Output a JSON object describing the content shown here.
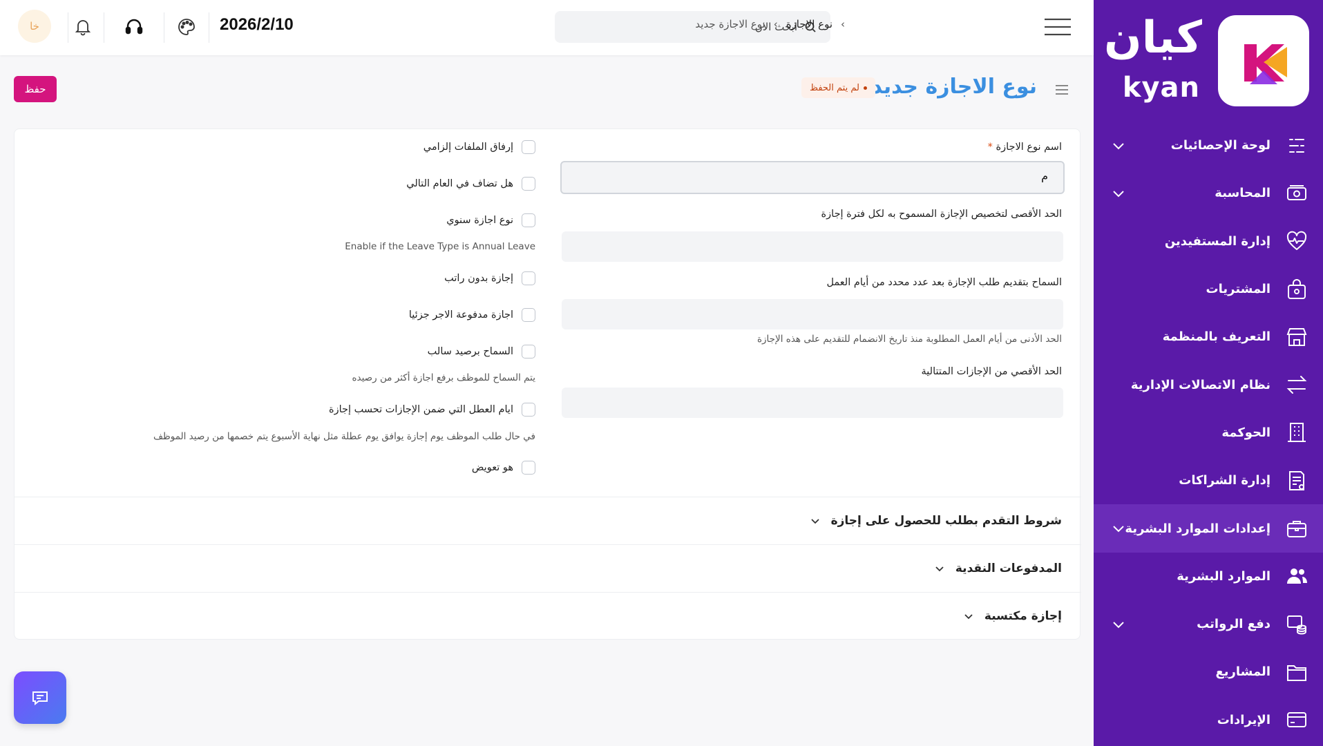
{
  "brand": {
    "name_ar": "كيان",
    "name_en": "kyan",
    "logo_letter": "k",
    "colors": {
      "sidebar": "#5a1aa8",
      "accent": "#d4147e",
      "title": "#3b8fe0",
      "logo_orange": "#f5a623"
    }
  },
  "sidebar": {
    "items": [
      {
        "label": "لوحة الإحصائيات",
        "icon": "stats-icon",
        "has_chevron": true,
        "active": false
      },
      {
        "label": "المحاسبة",
        "icon": "money-icon",
        "has_chevron": true,
        "active": false
      },
      {
        "label": "إدارة المستفيدين",
        "icon": "heart-pulse-icon",
        "has_chevron": false,
        "active": false
      },
      {
        "label": "المشتريات",
        "icon": "bag-icon",
        "has_chevron": false,
        "active": false
      },
      {
        "label": "التعريف بالمنظمة",
        "icon": "store-icon",
        "has_chevron": false,
        "active": false
      },
      {
        "label": "نظام الاتصالات الإدارية",
        "icon": "arrows-icon",
        "has_chevron": false,
        "active": false
      },
      {
        "label": "الحوكمة",
        "icon": "building-icon",
        "has_chevron": false,
        "active": false
      },
      {
        "label": "إدارة الشراكات",
        "icon": "document-icon",
        "has_chevron": false,
        "active": false
      },
      {
        "label": "إعدادات الموارد البشرية",
        "icon": "briefcase-icon",
        "has_chevron": true,
        "active": true
      },
      {
        "label": "الموارد البشرية",
        "icon": "users-icon",
        "has_chevron": false,
        "active": false
      },
      {
        "label": "دفع الرواتب",
        "icon": "coins-icon",
        "has_chevron": true,
        "active": false
      },
      {
        "label": "المشاريع",
        "icon": "folder-icon",
        "has_chevron": false,
        "active": false
      },
      {
        "label": "الإيرادات",
        "icon": "card-icon",
        "has_chevron": false,
        "active": false
      }
    ]
  },
  "topbar": {
    "avatar_initials": "خا",
    "date": "2026/2/10",
    "search_placeholder": "ابحث الان",
    "breadcrumb": [
      "نوع الاجازة",
      "نوع الاجازة جديد"
    ]
  },
  "page": {
    "title": "نوع الاجازة جديد",
    "status": "لم يتم الحفظ",
    "save_label": "حفظ"
  },
  "form": {
    "leave_type_name": {
      "label": "اسم نوع الاجازة",
      "required_mark": "*",
      "value": "م"
    },
    "max_allocation": {
      "label": "الحد الأقصى لتخصيص الإجازة المسموح به لكل فترة إجازة",
      "value": ""
    },
    "apply_after_days": {
      "label": "السماح بتقديم طلب الإجازة بعد عدد محدد من أيام العمل",
      "value": "",
      "help": "الحد الأدنى من أيام العمل المطلوبة منذ تاريخ الانضمام للتقديم على هذه الإجازة"
    },
    "max_consecutive": {
      "label": "الحد الأقصي من الإجازات المتتالية",
      "value": ""
    },
    "checkboxes": [
      {
        "label": "إرفاق الملفات إلزامي",
        "checked": false,
        "help": ""
      },
      {
        "label": "هل تضاف في العام التالي",
        "checked": false,
        "help": ""
      },
      {
        "label": "نوع اجازة سنوي",
        "checked": false,
        "help": "Enable if the Leave Type is Annual Leave"
      },
      {
        "label": "إجازة بدون راتب",
        "checked": false,
        "help": ""
      },
      {
        "label": "اجازة مدفوعة الاجر جزئيا",
        "checked": false,
        "help": ""
      },
      {
        "label": "السماح برصيد سالب",
        "checked": false,
        "help": "يتم السماح للموظف برفع اجازة أكثر من رصيده"
      },
      {
        "label": "ايام العطل التي ضمن الإجازات تحسب إجازة",
        "checked": false,
        "help": "في حال طلب الموظف يوم إجازة يوافق يوم عطلة مثل نهاية الأسبوع يتم خصمها من رصيد الموظف"
      },
      {
        "label": "هو تعويض",
        "checked": false,
        "help": ""
      }
    ]
  },
  "sections": [
    {
      "title": "شروط التقدم بطلب للحصول على إجازة"
    },
    {
      "title": "المدفوعات النقدية"
    },
    {
      "title": "إجازة مكتسبة"
    }
  ]
}
